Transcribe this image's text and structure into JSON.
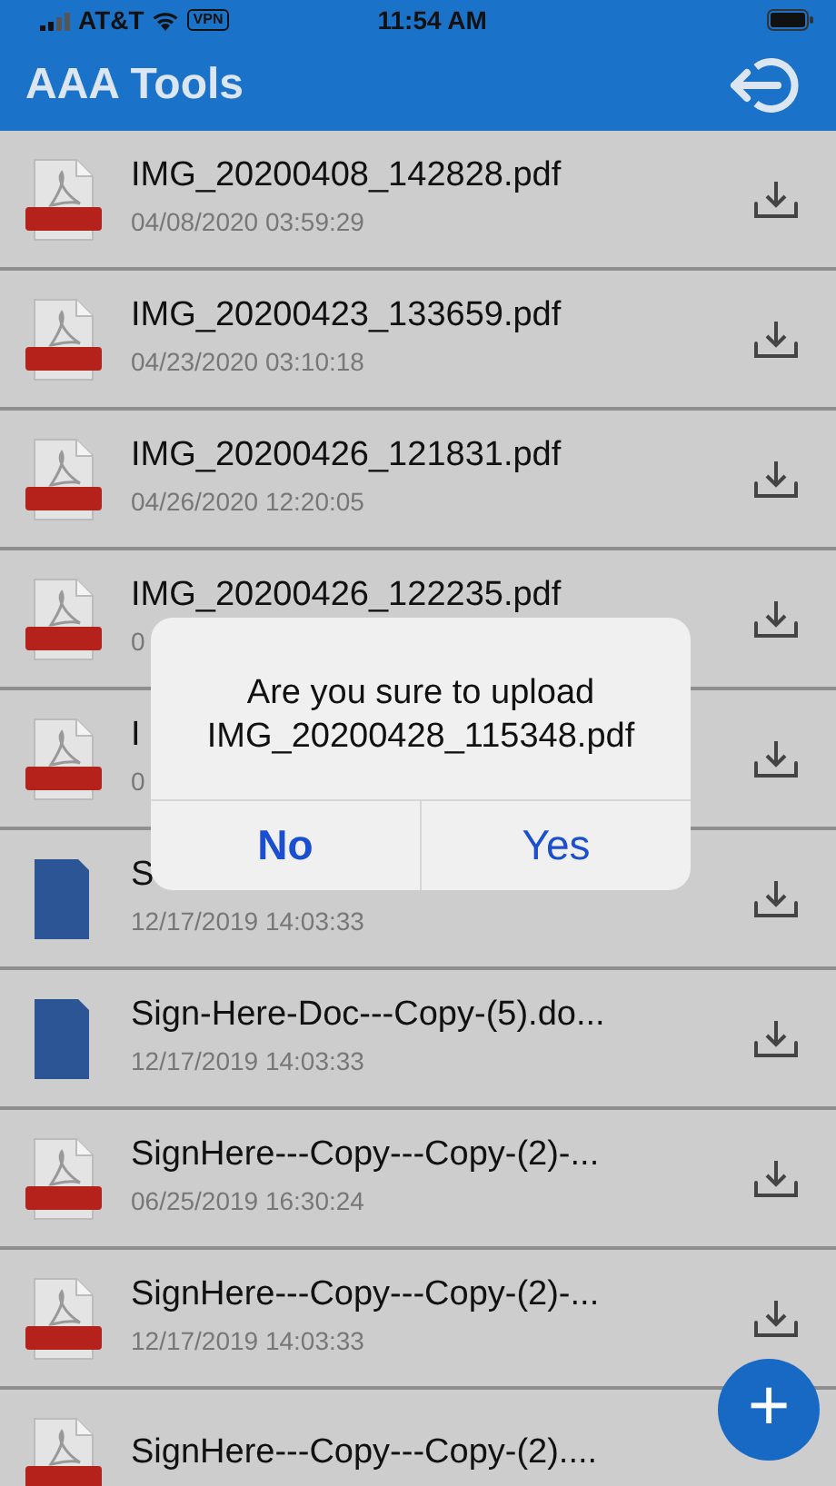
{
  "status_bar": {
    "carrier": "AT&T",
    "vpn": "VPN",
    "time": "11:54 AM"
  },
  "header": {
    "title": "AAA Tools"
  },
  "files": [
    {
      "kind": "pdf",
      "name": "IMG_20200408_142828.pdf",
      "date": "04/08/2020 03:59:29"
    },
    {
      "kind": "pdf",
      "name": "IMG_20200423_133659.pdf",
      "date": "04/23/2020 03:10:18"
    },
    {
      "kind": "pdf",
      "name": "IMG_20200426_121831.pdf",
      "date": "04/26/2020 12:20:05"
    },
    {
      "kind": "pdf",
      "name": "IMG_20200426_122235.pdf",
      "date": "0"
    },
    {
      "kind": "pdf",
      "name": "I",
      "date": "0"
    },
    {
      "kind": "docx",
      "name": "S",
      "date": "12/17/2019 14:03:33"
    },
    {
      "kind": "docx",
      "name": "Sign-Here-Doc---Copy-(5).do...",
      "date": "12/17/2019 14:03:33"
    },
    {
      "kind": "pdf",
      "name": "SignHere---Copy---Copy-(2)-...",
      "date": "06/25/2019 16:30:24"
    },
    {
      "kind": "pdf",
      "name": "SignHere---Copy---Copy-(2)-...",
      "date": "12/17/2019 14:03:33"
    },
    {
      "kind": "pdf",
      "name": "SignHere---Copy---Copy-(2)...."
    }
  ],
  "dialog": {
    "message": "Are you sure to upload IMG_20200428_115348.pdf",
    "buttons": [
      {
        "label": "No",
        "kind": "primary"
      },
      {
        "label": "Yes",
        "kind": "default"
      }
    ]
  },
  "fab": {
    "label": "+"
  }
}
